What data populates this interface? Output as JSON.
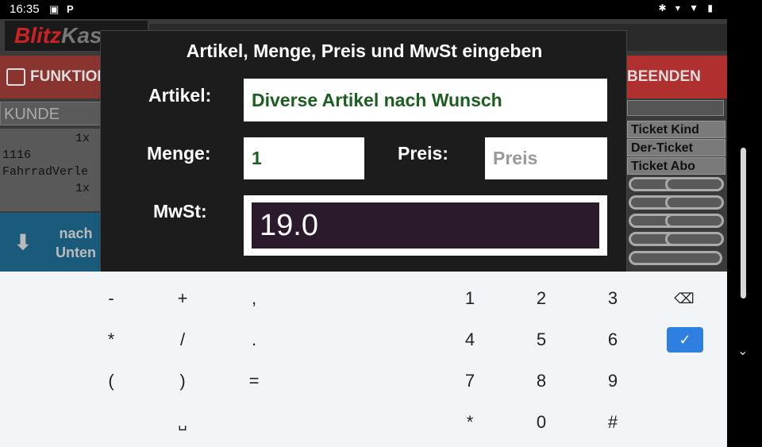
{
  "status_bar": {
    "time": "16:35",
    "icons": [
      "image-icon",
      "parking-icon"
    ],
    "right_icons": "✱ ▾ ▼ ▮"
  },
  "app": {
    "logo_part1": "Blitz",
    "logo_part2": "Kasse",
    "funktionen_label": "FUNKTIONEN",
    "beenden_label": "BEENDEN",
    "kunde_placeholder": "KUNDE AUSWÄHLEN",
    "list": {
      "qty1": "1x",
      "code": "1116",
      "name": "FahrradVerle",
      "qty2": "1x"
    },
    "nav_down": {
      "line1": "nach",
      "line2": "Unten"
    },
    "right_buttons": [
      "Ticket Kind",
      "Der-Ticket",
      "Ticket Abo"
    ]
  },
  "dialog": {
    "title": "Artikel, Menge, Preis und MwSt eingeben",
    "artikel_label": "Artikel:",
    "artikel_value": "Diverse Artikel nach Wunsch",
    "menge_label": "Menge:",
    "menge_value": "1",
    "preis_label": "Preis:",
    "preis_placeholder": "Preis",
    "mwst_label": "MwSt:",
    "mwst_value": "19.0"
  },
  "keyboard": {
    "row1": [
      "-",
      "+",
      ",",
      "1",
      "2",
      "3"
    ],
    "row2": [
      "*",
      "/",
      ".",
      "4",
      "5",
      "6"
    ],
    "row3": [
      "(",
      ")",
      "=",
      "7",
      "8",
      "9"
    ],
    "row4": [
      "␣",
      "*",
      "0",
      "#"
    ],
    "backspace_icon": "⌫",
    "enter_icon": "✓",
    "accent_color": "#2f7fe0"
  },
  "system": {
    "hide_keyboard_icon": "⌄"
  }
}
